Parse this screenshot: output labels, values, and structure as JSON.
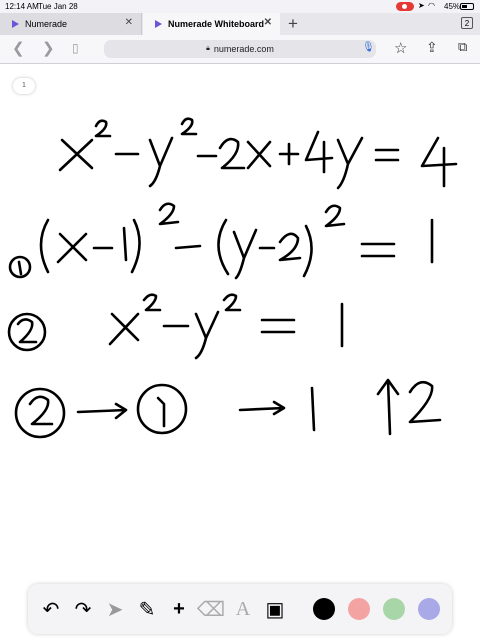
{
  "status_bar": {
    "time": "12:14 AM",
    "date": "Tue Jan 28",
    "battery": "45%"
  },
  "tabs": [
    {
      "label": "Numerade",
      "active": false
    },
    {
      "label": "Numerade Whiteboard",
      "active": true
    }
  ],
  "tab_count": "2",
  "url": "numerade.com",
  "page_indicator": "1",
  "whiteboard": {
    "line1": "x² − y² − 2x + 4y = 4",
    "line2_marker": "1",
    "line2": "(x − 1)² − (y − 2)² = 1",
    "line3_marker": "2",
    "line3": "x² − y² = 1",
    "line4_marker_a": "2",
    "line4_marker_b": "1",
    "line4_right_a": "1",
    "line4_right_b": "2"
  },
  "toolbar": {
    "tools": [
      "undo-icon",
      "redo-icon",
      "pointer-icon",
      "pencil-icon",
      "plus-icon",
      "eraser-icon",
      "text-icon",
      "image-icon"
    ],
    "text_tool_label": "A",
    "colors": [
      "#000000",
      "#f4a3a3",
      "#a8d6a8",
      "#a9a9e8"
    ]
  }
}
